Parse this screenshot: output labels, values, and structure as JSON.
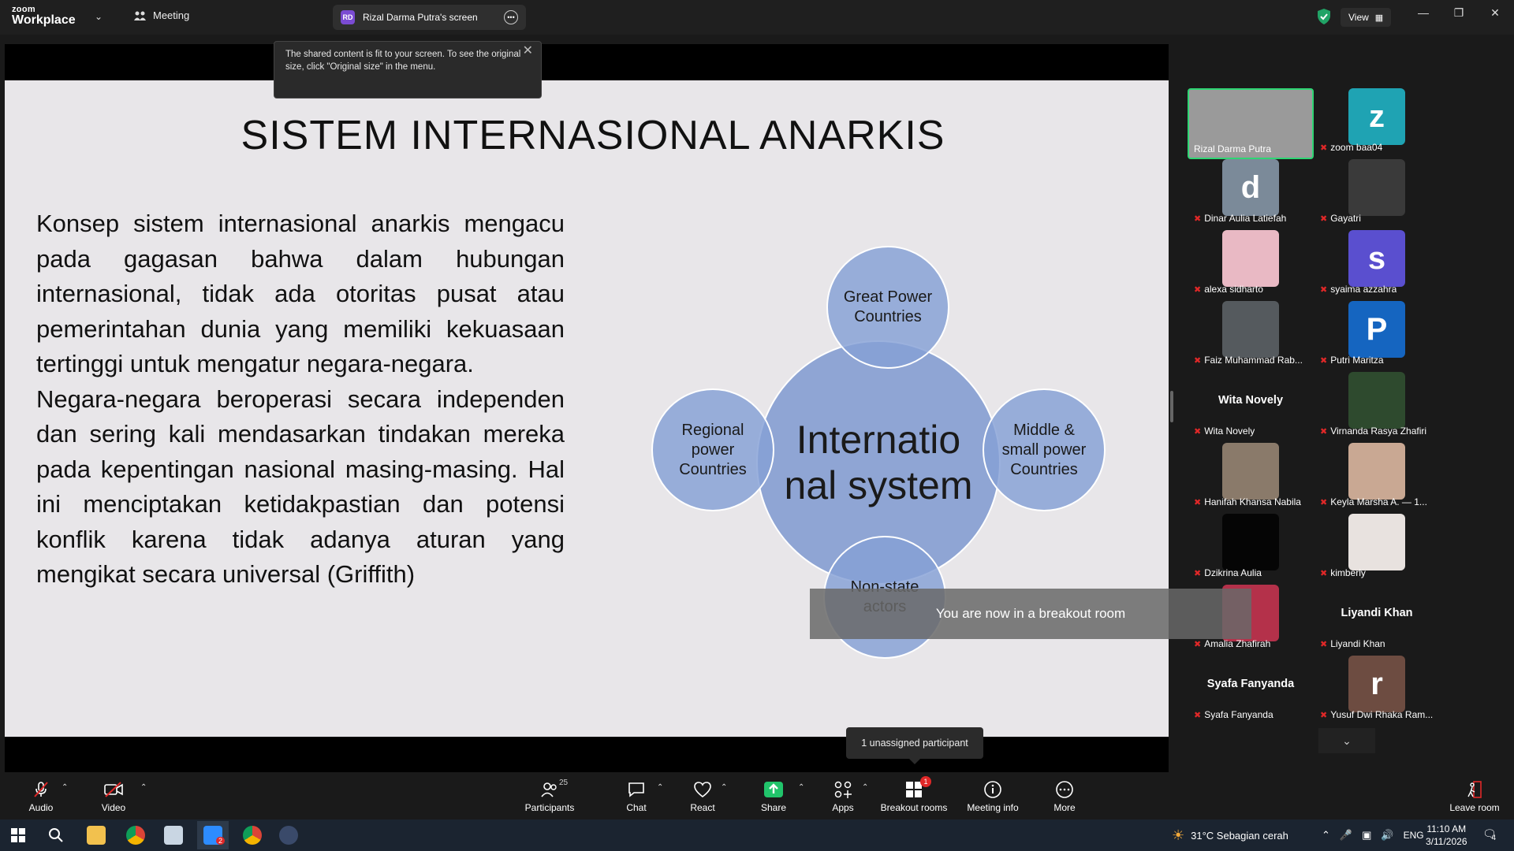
{
  "topbar": {
    "logo_line1": "zoom",
    "logo_line2": "Workplace",
    "meeting_label": "Meeting",
    "share_initials": "RD",
    "share_title": "Rizal Darma Putra's screen",
    "view_label": "View"
  },
  "tooltip": {
    "text": "The shared content is fit to your screen. To see the original size, click \"Original size\" in the menu."
  },
  "slide": {
    "title": "SISTEM INTERNASIONAL ANARKIS",
    "paragraphs": [
      "Konsep sistem internasional anarkis mengacu pada gagasan bahwa dalam hubungan internasional, tidak ada otoritas pusat atau pemerintahan dunia yang memiliki kekuasaan tertinggi untuk mengatur negara-negara.",
      "Negara-negara beroperasi secara independen dan sering kali mendasarkan tindakan mereka pada kepentingan nasional masing-masing. Hal ini menciptakan ketidakpastian dan potensi konflik karena tidak adanya aturan yang mengikat secara universal (Griffith)"
    ],
    "diagram": {
      "center": "Internatio nal system",
      "top": "Great Power Countries",
      "left": "Regional power Countries",
      "right": "Middle & small power Countries",
      "bottom": "Non-state actors"
    }
  },
  "toast": "You are now in a breakout room",
  "unassigned_tooltip": "1 unassigned participant",
  "participants": [
    {
      "name": "Rizal Darma Putra",
      "type": "video",
      "color": "#9a9a9a",
      "active": true
    },
    {
      "name": "zoom baa04",
      "type": "letter",
      "letter": "z",
      "color": "#1fa3b3"
    },
    {
      "name": "Dinar Aulia Latiefah",
      "type": "letter",
      "letter": "d",
      "color": "#7b8a99"
    },
    {
      "name": "Gayatri",
      "type": "photo",
      "color": "#3a3a3a"
    },
    {
      "name": "alexa sidharto",
      "type": "photo",
      "color": "#e9b9c4"
    },
    {
      "name": "syaima azzahra",
      "type": "letter",
      "letter": "s",
      "color": "#5a4fcf"
    },
    {
      "name": "Faiz Muhammad Rab...",
      "type": "photo",
      "color": "#555a5e"
    },
    {
      "name": "Putri Maritza",
      "type": "letter",
      "letter": "P",
      "color": "#1565c0"
    },
    {
      "name": "Wita Novely",
      "type": "name",
      "big": "Wita Novely"
    },
    {
      "name": "Virnanda Rasya Zhafiri",
      "type": "photo",
      "color": "#2e4a2e"
    },
    {
      "name": "Hanifah Khansa Nabila",
      "type": "photo",
      "color": "#8a7a6a"
    },
    {
      "name": "Keyla Marsha A. — 1...",
      "type": "photo",
      "color": "#c9a893"
    },
    {
      "name": "Dzikrina Aulia",
      "type": "photo",
      "color": "#050505"
    },
    {
      "name": "kimberly",
      "type": "photo",
      "color": "#e8e2df"
    },
    {
      "name": "Amalia Zhafirah",
      "type": "photo",
      "color": "#b4314a"
    },
    {
      "name": "Liyandi Khan",
      "type": "name",
      "big": "Liyandi Khan"
    },
    {
      "name": "Syafa Fanyanda",
      "type": "name",
      "big": "Syafa Fanyanda"
    },
    {
      "name": "Yusuf Dwi Rhaka Ram...",
      "type": "letter",
      "letter": "r",
      "color": "#6d4c41"
    }
  ],
  "toolbar": {
    "audio": "Audio",
    "video": "Video",
    "participants": "Participants",
    "participant_count": "25",
    "chat": "Chat",
    "react": "React",
    "share": "Share",
    "apps": "Apps",
    "breakout": "Breakout rooms",
    "breakout_badge": "1",
    "meeting_info": "Meeting info",
    "more": "More",
    "leave": "Leave room"
  },
  "taskbar": {
    "zoom_badge": "2",
    "weather": "31°C  Sebagian cerah",
    "lang": "ENG",
    "time": "11:10 AM",
    "date": "3/11/2026",
    "notif_count": "4"
  }
}
